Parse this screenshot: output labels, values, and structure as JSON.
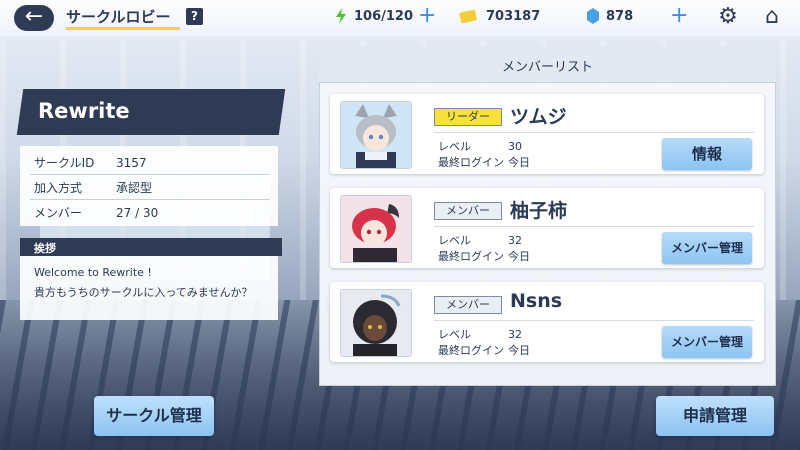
{
  "header": {
    "title": "サークルロビー",
    "help_icon": "?",
    "stamina": "106/120",
    "coins": "703187",
    "gems": "878",
    "icons": [
      "back-arrow-icon",
      "help-icon",
      "stamina-bolt-icon",
      "coin-ticket-icon",
      "gem-icon",
      "plus-icon",
      "gear-icon",
      "home-icon"
    ]
  },
  "circle": {
    "name": "Rewrite",
    "info": [
      {
        "key": "サークルID",
        "value": "3157"
      },
      {
        "key": "加入方式",
        "value": "承認型"
      },
      {
        "key": "メンバー",
        "value": "27 / 30"
      }
    ],
    "greeting_label": "挨拶",
    "greeting_lines": [
      "Welcome to Rewrite !",
      "貴方もうちのサークルに入ってみませんか？"
    ]
  },
  "member_list": {
    "title": "メンバーリスト",
    "level_label": "レベル",
    "last_login_label": "最終ログイン",
    "members": [
      {
        "role": "リーダー",
        "name": "ツムジ",
        "level": "30",
        "last_login": "今日",
        "button": "情報",
        "role_color": "#f7e23a"
      },
      {
        "role": "メンバー",
        "name": "柚子柿",
        "level": "32",
        "last_login": "今日",
        "button": "メンバー管理",
        "role_color": "#e9eef5"
      },
      {
        "role": "メンバー",
        "name": "Nsns",
        "level": "32",
        "last_login": "今日",
        "button": "メンバー管理",
        "role_color": "#e9eef5"
      }
    ]
  },
  "footer": {
    "circle_manage": "サークル管理",
    "application_manage": "申請管理"
  }
}
